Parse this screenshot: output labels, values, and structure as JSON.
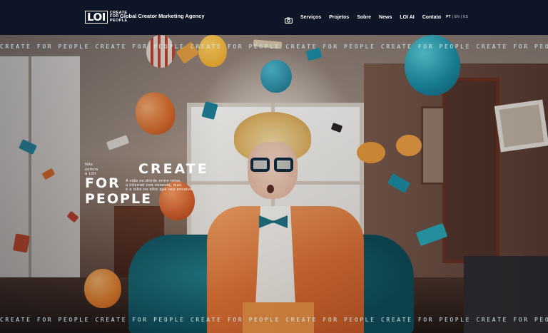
{
  "header": {
    "logo_mark": "LOI",
    "logo_words": [
      "CREATE",
      "FOR",
      "PEOPLE"
    ],
    "tagline": "Global Creator Marketing Agency",
    "nav": [
      {
        "label": "Serviços"
      },
      {
        "label": "Projetos"
      },
      {
        "label": "Sobre"
      },
      {
        "label": "News"
      },
      {
        "label": "LOI AI"
      },
      {
        "label": "Contato"
      }
    ],
    "camera_icon": "camera-icon",
    "languages": {
      "active": "PT",
      "sep1": "|",
      "en": "EN",
      "sep2": "|",
      "es": "ES"
    }
  },
  "hero": {
    "marquee_text": "CREATE FOR PEOPLE CREATE FOR PEOPLE CREATE FOR PEOPLE CREATE FOR PEOPLE CREATE FOR PEOPLE CREATE FOR PEOPLE CREATE FOR PEOPLE",
    "intro_lines": [
      "Nós",
      "somos",
      "a LOI"
    ],
    "headline_create": "CREATE",
    "headline_for": "FOR",
    "headline_people": "PEOPLE",
    "subtitle_lines": [
      "A vida se divide entre telas,",
      "a internet nos conecta, mas",
      "é o olho no olho que nos envolve"
    ]
  },
  "colors": {
    "header_bg": "#0d1526",
    "text": "#ffffff",
    "balloon_teal": "#1a8ea4",
    "balloon_orange": "#e0702a"
  }
}
